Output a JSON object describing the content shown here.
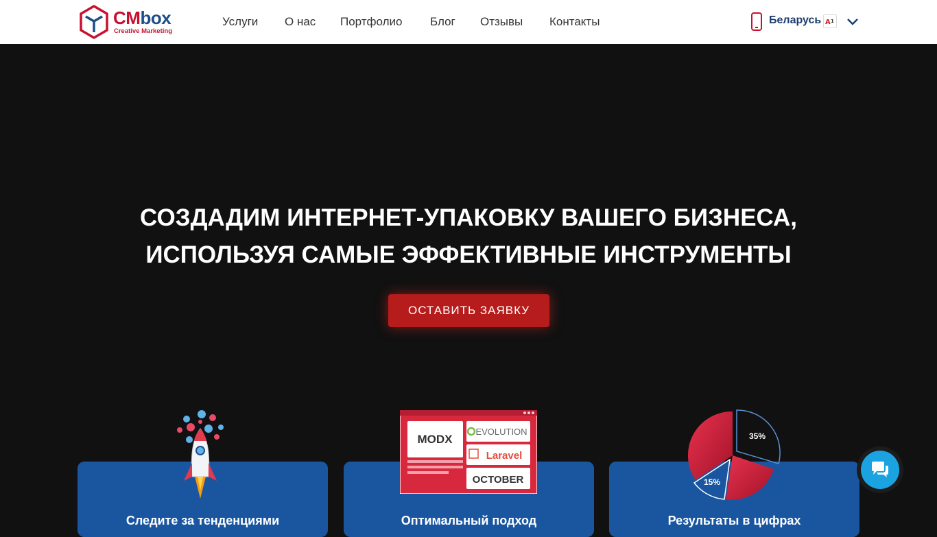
{
  "header": {
    "logo": {
      "main_cm": "CM",
      "main_box": "box",
      "sub": "Creative Marketing"
    },
    "nav": [
      {
        "label": "Услуги"
      },
      {
        "label": "О нас"
      },
      {
        "label": "Портфолио"
      },
      {
        "label": "Блог"
      },
      {
        "label": "Отзывы"
      },
      {
        "label": "Контакты"
      }
    ],
    "region": {
      "label": "Беларусь",
      "flag_text": "A1"
    }
  },
  "hero": {
    "title_line1": "СОЗДАДИМ ИНТЕРНЕТ-УПАКОВКУ ВАШЕГО БИЗНЕСА,",
    "title_line2": "ИСПОЛЬЗУЯ САМЫЕ ЭФФЕКТИВНЫЕ ИНСТРУМЕНТЫ",
    "cta_label": "ОСТАВИТЬ ЗАЯВКУ"
  },
  "cards": [
    {
      "title": "Следите за тенденциями",
      "icon": "rocket-icon"
    },
    {
      "title": "Оптимальный подход",
      "icon": "cms-icon",
      "cms": [
        "MODX",
        "EVOLUTION",
        "Laravel",
        "OCTOBER"
      ]
    },
    {
      "title": "Результаты в цифрах",
      "icon": "pie-chart-icon",
      "percent_a": "35%",
      "percent_b": "15%"
    }
  ],
  "colors": {
    "accent_red": "#c8102e",
    "brand_blue": "#1c4e8a",
    "card_blue": "#1a56a0",
    "cta_red": "#b71c1c",
    "chat_blue": "#1aa3e0",
    "background": "#111111"
  }
}
